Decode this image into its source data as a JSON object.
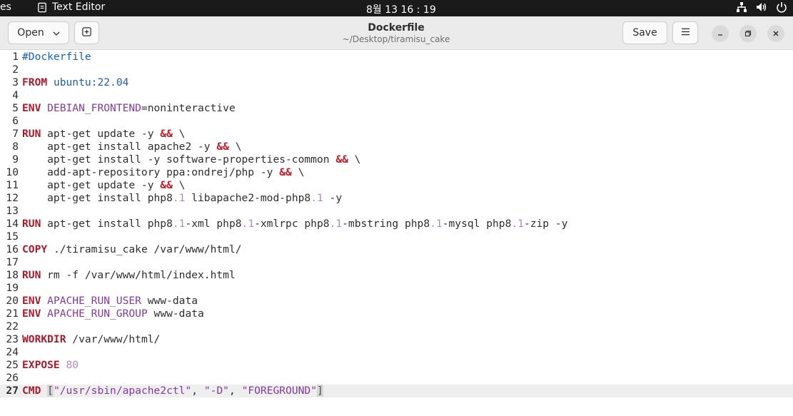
{
  "topbar": {
    "activities": "es",
    "app_name": "Text Editor",
    "clock": "8월 13  16 : 19",
    "tray_icons": [
      "network-icon",
      "volume-icon",
      "power-icon"
    ]
  },
  "header": {
    "open_label": "Open",
    "title": "Dockerfile",
    "subtitle": "~/Desktop/tiramisu_cake",
    "save_label": "Save"
  },
  "editor": {
    "current_line": 27,
    "lines": [
      {
        "n": "1",
        "tokens": [
          {
            "t": "#Dockerfile",
            "c": "val"
          }
        ]
      },
      {
        "n": "2",
        "tokens": []
      },
      {
        "n": "3",
        "tokens": [
          {
            "t": "FROM",
            "c": "kw"
          },
          {
            "t": " "
          },
          {
            "t": "ubuntu:22.04",
            "c": "val"
          }
        ]
      },
      {
        "n": "4",
        "tokens": []
      },
      {
        "n": "5",
        "tokens": [
          {
            "t": "ENV",
            "c": "kw"
          },
          {
            "t": " "
          },
          {
            "t": "DEBIAN_FRONTEND",
            "c": "var"
          },
          {
            "t": "=noninteractive"
          }
        ]
      },
      {
        "n": "6",
        "tokens": []
      },
      {
        "n": "7",
        "tokens": [
          {
            "t": "RUN",
            "c": "kw"
          },
          {
            "t": " apt-get update -y "
          },
          {
            "t": "&&",
            "c": "op"
          },
          {
            "t": " \\"
          }
        ]
      },
      {
        "n": "8",
        "tokens": [
          {
            "t": "    apt-get install apache2 -y "
          },
          {
            "t": "&&",
            "c": "op"
          },
          {
            "t": " \\"
          }
        ]
      },
      {
        "n": "9",
        "tokens": [
          {
            "t": "    apt-get install -y software-properties-common "
          },
          {
            "t": "&&",
            "c": "op"
          },
          {
            "t": " \\"
          }
        ]
      },
      {
        "n": "10",
        "tokens": [
          {
            "t": "    add-apt-repository ppa:ondrej/php -y "
          },
          {
            "t": "&&",
            "c": "op"
          },
          {
            "t": " \\"
          }
        ]
      },
      {
        "n": "11",
        "tokens": [
          {
            "t": "    apt-get update -y "
          },
          {
            "t": "&&",
            "c": "op"
          },
          {
            "t": " \\"
          }
        ]
      },
      {
        "n": "12",
        "tokens": [
          {
            "t": "    apt-get install php8"
          },
          {
            "t": ".1",
            "c": "num"
          },
          {
            "t": " libapache2-mod-php8"
          },
          {
            "t": ".1",
            "c": "num"
          },
          {
            "t": " -y"
          }
        ]
      },
      {
        "n": "13",
        "tokens": []
      },
      {
        "n": "14",
        "tokens": [
          {
            "t": "RUN",
            "c": "kw"
          },
          {
            "t": " apt-get install php8"
          },
          {
            "t": ".1",
            "c": "num"
          },
          {
            "t": "-xml php8"
          },
          {
            "t": ".1",
            "c": "num"
          },
          {
            "t": "-xmlrpc php8"
          },
          {
            "t": ".1",
            "c": "num"
          },
          {
            "t": "-mbstring php8"
          },
          {
            "t": ".1",
            "c": "num"
          },
          {
            "t": "-mysql php8"
          },
          {
            "t": ".1",
            "c": "num"
          },
          {
            "t": "-zip -y"
          }
        ]
      },
      {
        "n": "15",
        "tokens": []
      },
      {
        "n": "16",
        "tokens": [
          {
            "t": "COPY",
            "c": "kw"
          },
          {
            "t": " ./tiramisu_cake /var/www/html/"
          }
        ]
      },
      {
        "n": "17",
        "tokens": []
      },
      {
        "n": "18",
        "tokens": [
          {
            "t": "RUN",
            "c": "kw"
          },
          {
            "t": " rm -f /var/www/html/index.html"
          }
        ]
      },
      {
        "n": "19",
        "tokens": []
      },
      {
        "n": "20",
        "tokens": [
          {
            "t": "ENV",
            "c": "kw"
          },
          {
            "t": " "
          },
          {
            "t": "APACHE_RUN_USER",
            "c": "var"
          },
          {
            "t": " www-data"
          }
        ]
      },
      {
        "n": "21",
        "tokens": [
          {
            "t": "ENV",
            "c": "kw"
          },
          {
            "t": " "
          },
          {
            "t": "APACHE_RUN_GROUP",
            "c": "var"
          },
          {
            "t": " www-data"
          }
        ]
      },
      {
        "n": "22",
        "tokens": []
      },
      {
        "n": "23",
        "tokens": [
          {
            "t": "WORKDIR",
            "c": "kw"
          },
          {
            "t": " /var/www/html/"
          }
        ]
      },
      {
        "n": "24",
        "tokens": []
      },
      {
        "n": "25",
        "tokens": [
          {
            "t": "EXPOSE",
            "c": "kw"
          },
          {
            "t": " "
          },
          {
            "t": "80",
            "c": "num"
          }
        ]
      },
      {
        "n": "26",
        "tokens": []
      },
      {
        "n": "27",
        "tokens": [
          {
            "t": "CMD",
            "c": "kw"
          },
          {
            "t": " "
          },
          {
            "t": "[",
            "c": "brk"
          },
          {
            "t": "\"/usr/sbin/apache2ctl\"",
            "c": "str"
          },
          {
            "t": ", "
          },
          {
            "t": "\"-D\"",
            "c": "str"
          },
          {
            "t": ", "
          },
          {
            "t": "\"FOREGROUND\"",
            "c": "str"
          },
          {
            "t": "]",
            "c": "brk"
          }
        ]
      }
    ]
  }
}
